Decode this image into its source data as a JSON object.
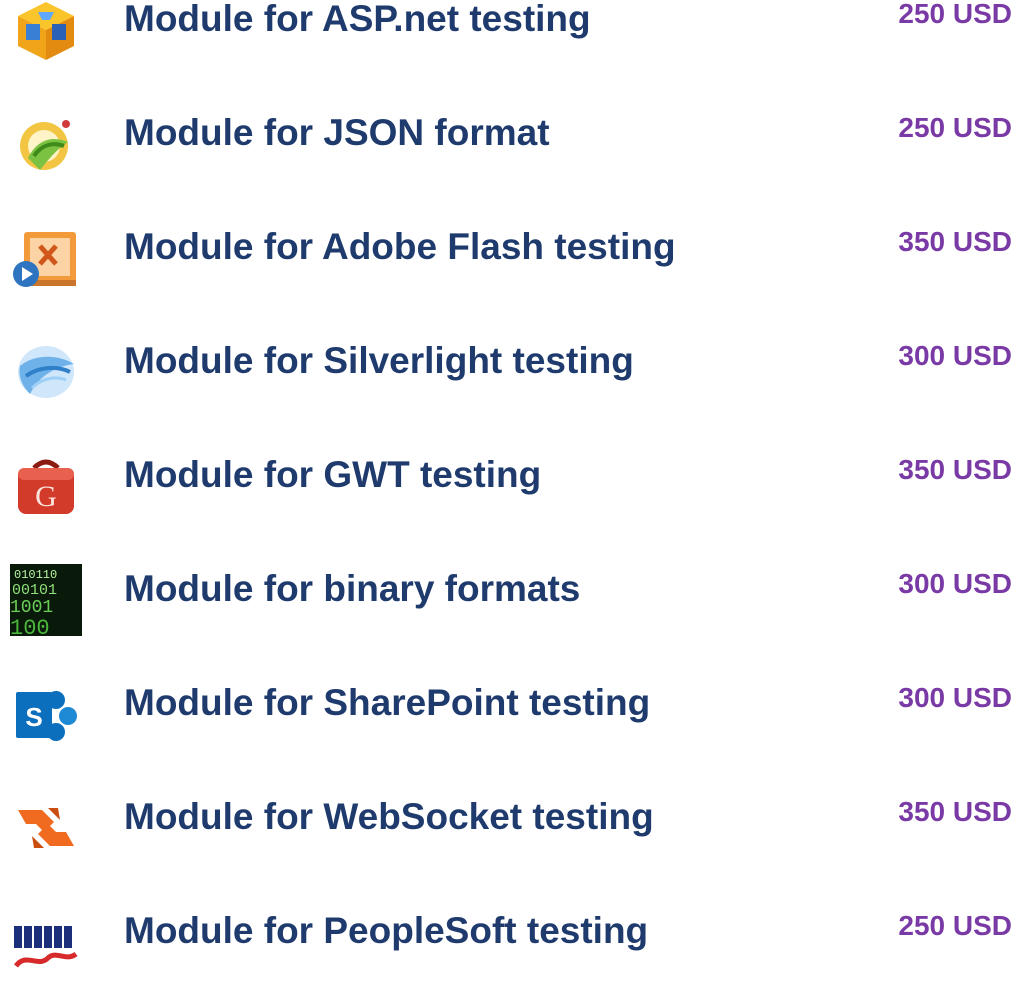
{
  "modules": [
    {
      "name": "Module for ASP.net testing",
      "price": "250 USD",
      "icon": "aspnet-cube-icon"
    },
    {
      "name": "Module for JSON format",
      "price": "250 USD",
      "icon": "json-icon"
    },
    {
      "name": "Module for Adobe Flash testing",
      "price": "350 USD",
      "icon": "flash-video-icon"
    },
    {
      "name": "Module for Silverlight testing",
      "price": "300 USD",
      "icon": "silverlight-icon"
    },
    {
      "name": "Module for GWT testing",
      "price": "350 USD",
      "icon": "gwt-toolbox-icon"
    },
    {
      "name": "Module for binary formats",
      "price": "300 USD",
      "icon": "binary-code-icon"
    },
    {
      "name": "Module for SharePoint testing",
      "price": "300 USD",
      "icon": "sharepoint-icon"
    },
    {
      "name": "Module for WebSocket testing",
      "price": "350 USD",
      "icon": "websocket-icon"
    },
    {
      "name": "Module for PeopleSoft testing",
      "price": "250 USD",
      "icon": "peoplesoft-logo-icon"
    }
  ],
  "colors": {
    "module_name": "#1f3b6e",
    "price": "#7a3aa6"
  }
}
